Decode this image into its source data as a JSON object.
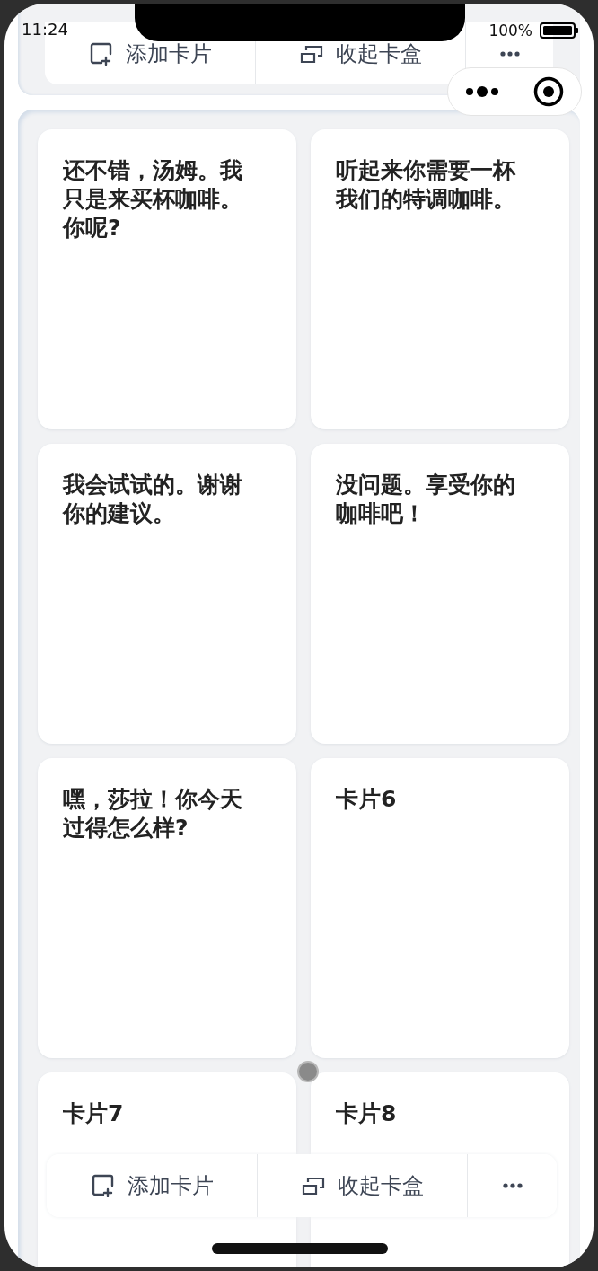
{
  "status_bar": {
    "time": "11:24",
    "battery": "100%"
  },
  "top_toolbar": {
    "buttons": [
      {
        "kind": "add",
        "label": "添加卡片"
      },
      {
        "kind": "collapse",
        "label": "收起卡盒"
      },
      {
        "kind": "more"
      }
    ]
  },
  "cards": [
    {
      "text": "还不错，汤姆。我只是来买杯咖啡。你呢?"
    },
    {
      "text": "听起来你需要一杯我们的特调咖啡。"
    },
    {
      "text": "我会试试的。谢谢你的建议。"
    },
    {
      "text": "没问题。享受你的咖啡吧！"
    },
    {
      "text": "嘿，莎拉！你今天过得怎么样?"
    },
    {
      "text": "卡片6"
    },
    {
      "text": "卡片7"
    },
    {
      "text": "卡片8"
    }
  ],
  "bottom_toolbar": {
    "buttons": [
      {
        "kind": "add",
        "label": "添加卡片"
      },
      {
        "kind": "collapse",
        "label": "收起卡盒"
      },
      {
        "kind": "more"
      }
    ]
  }
}
